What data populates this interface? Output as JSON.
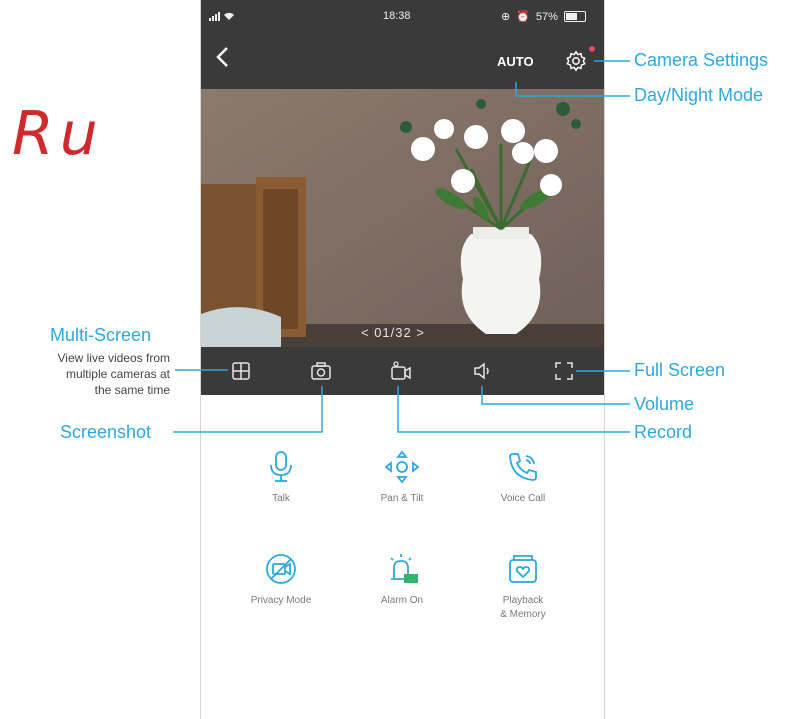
{
  "watermark": "Ru",
  "status_bar": {
    "time": "18:38",
    "battery": "57%"
  },
  "header": {
    "mode_label": "AUTO"
  },
  "video": {
    "counter": "<  01/32  >"
  },
  "actions": [
    {
      "label": "Talk"
    },
    {
      "label": "Pan & Tilt"
    },
    {
      "label": "Voice Call"
    },
    {
      "label": "Privacy Mode"
    },
    {
      "label": "Alarm On"
    },
    {
      "label": "Playback\n& Memory"
    }
  ],
  "callouts": {
    "camera_settings": "Camera Settings",
    "day_night_mode": "Day/Night Mode",
    "multi_screen": "Multi-Screen",
    "multi_screen_desc": "View live videos from\nmultiple cameras at\nthe same time",
    "full_screen": "Full Screen",
    "volume": "Volume",
    "screenshot": "Screenshot",
    "record": "Record"
  },
  "colors": {
    "accent": "#2da8e0",
    "bar": "#3a3a3a",
    "brand_red": "#d0282b",
    "badge": "#e8475f"
  }
}
